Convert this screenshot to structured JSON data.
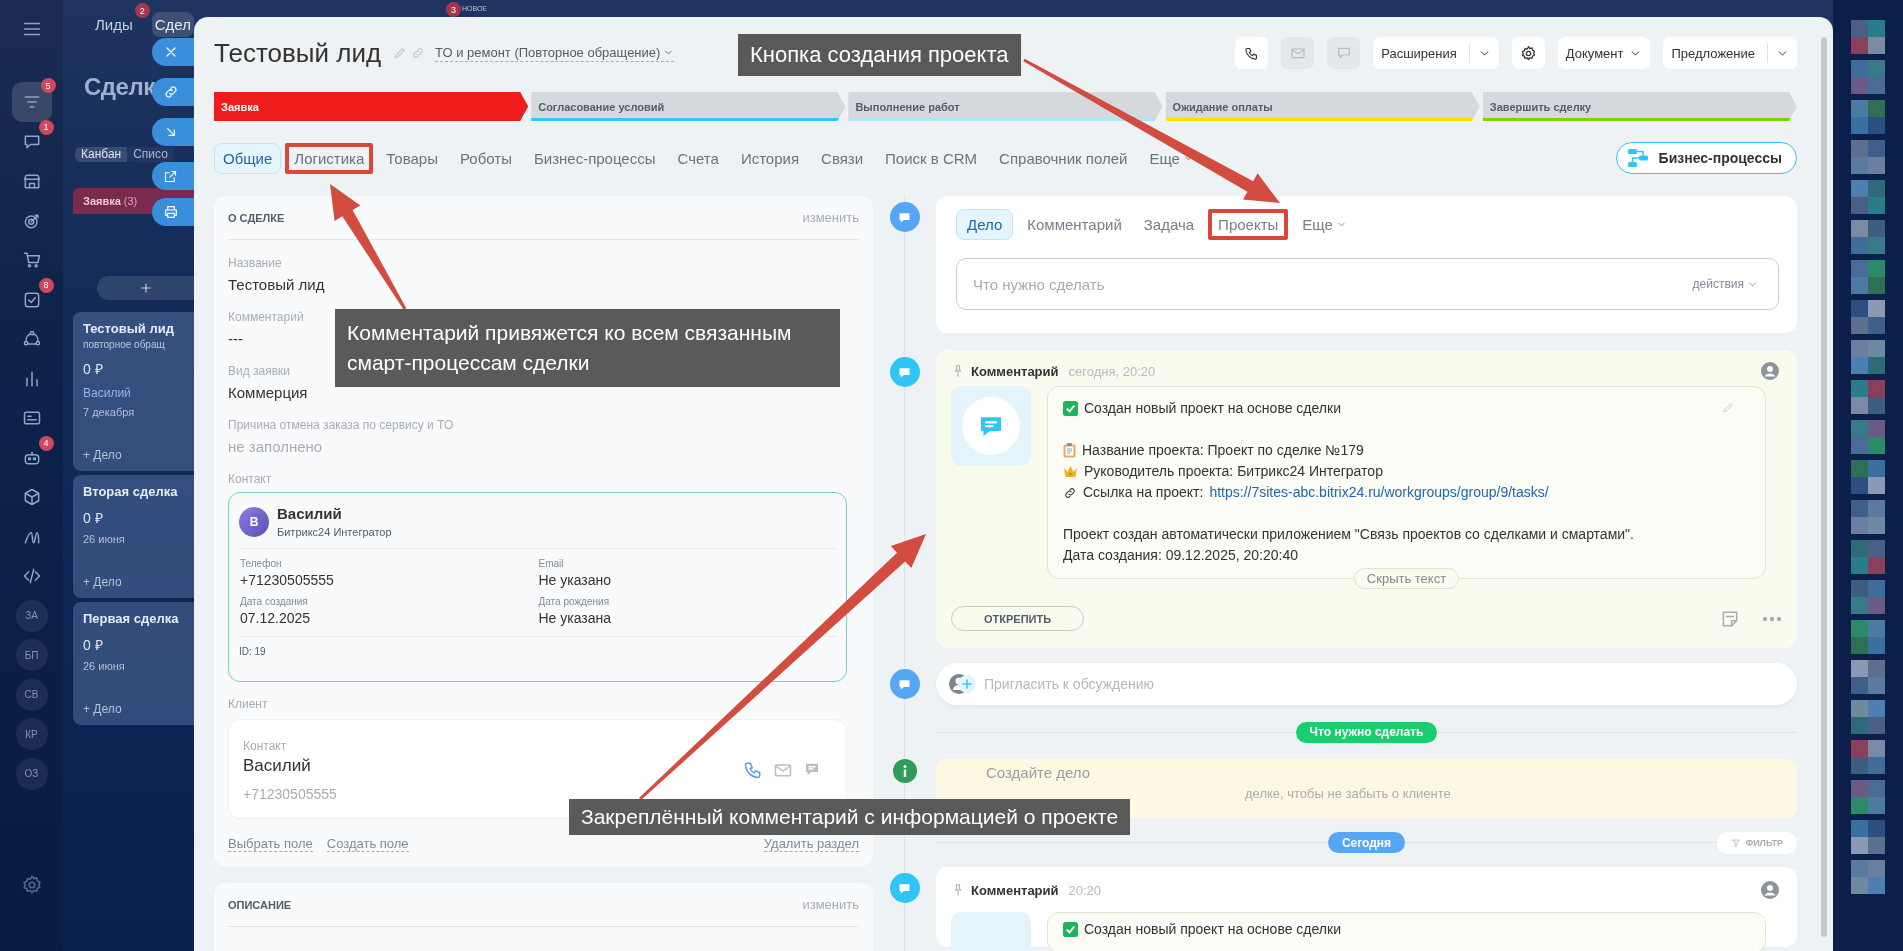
{
  "left_nav": {
    "items": [
      {
        "kind": "icon",
        "badge": "5",
        "selected": true
      },
      {
        "kind": "icon",
        "badge": "1",
        "selected": false
      },
      {
        "kind": "icon",
        "selected": false
      },
      {
        "kind": "icon",
        "selected": false
      },
      {
        "kind": "icon",
        "selected": false
      },
      {
        "kind": "icon",
        "badge": "8",
        "selected": false
      },
      {
        "kind": "icon",
        "selected": false
      },
      {
        "kind": "icon",
        "selected": false
      },
      {
        "kind": "icon",
        "selected": false
      },
      {
        "kind": "icon",
        "badge": "4",
        "selected": false
      },
      {
        "kind": "icon",
        "selected": false
      },
      {
        "kind": "icon",
        "selected": false
      },
      {
        "kind": "icon",
        "selected": false
      },
      {
        "kind": "text",
        "label": "ЗА",
        "selected": false
      },
      {
        "kind": "text",
        "label": "БП",
        "selected": false
      },
      {
        "kind": "text",
        "label": "СВ",
        "selected": false
      },
      {
        "kind": "text",
        "label": "КР",
        "selected": false
      },
      {
        "kind": "text",
        "label": "ОЗ",
        "selected": false
      }
    ]
  },
  "kanban": {
    "top_tabs": [
      {
        "label": "Лиды",
        "badge": "2",
        "selected": false
      },
      {
        "label": "Сдел",
        "selected": true
      }
    ],
    "news": {
      "label": "НОВОЕ",
      "badge": "3"
    },
    "title": "Сделк",
    "view_tabs": [
      {
        "label": "Канбан",
        "selected": true
      },
      {
        "label": "Списо",
        "selected": false
      }
    ],
    "column": {
      "title": "Заявка",
      "count": "(3)",
      "color": "#7a2a4c"
    },
    "cards": [
      {
        "title": "Тестовый лид",
        "subtitle": "повторное обращ",
        "amount": "0 ₽",
        "contact": "Василий",
        "date": "7 декабря",
        "add": "+ Дело"
      },
      {
        "title": "Вторая сделка",
        "amount": "0 ₽",
        "date": "26 июня",
        "add": "+ Дело"
      },
      {
        "title": "Первая сделка",
        "amount": "0 ₽",
        "date": "26 июня",
        "add": "+ Дело"
      }
    ]
  },
  "deal": {
    "title": "Тестовый лид",
    "category": "ТО и ремонт (Повторное обращение)",
    "actions": [
      {
        "kind": "phone",
        "disabled": false
      },
      {
        "kind": "mail",
        "disabled": true
      },
      {
        "kind": "chat",
        "disabled": true
      },
      {
        "kind": "split",
        "label": "Расширения",
        "disabled": false
      },
      {
        "kind": "gear",
        "disabled": false
      },
      {
        "kind": "dropdown",
        "label": "Документ",
        "disabled": false
      },
      {
        "kind": "split",
        "label": "Предложение",
        "disabled": false
      }
    ]
  },
  "stages": [
    {
      "label": "Заявка",
      "color": "#ee1c1c",
      "selected": true
    },
    {
      "label": "Согласование условий",
      "color": "#2fc6f6",
      "selected": false
    },
    {
      "label": "Выполнение работ",
      "color": "#b3e3f7",
      "selected": false
    },
    {
      "label": "Ожидание оплаты",
      "color": "#ffe100",
      "selected": false
    },
    {
      "label": "Завершить сделку",
      "color": "#7bd500",
      "selected": false
    }
  ],
  "tabs": [
    {
      "label": "Общие",
      "kind": "tab",
      "selected": true,
      "highlighted": false
    },
    {
      "label": "Логистика",
      "kind": "tab",
      "selected": false,
      "highlighted": true
    },
    {
      "label": "Товары",
      "kind": "tab",
      "selected": false,
      "highlighted": false
    },
    {
      "label": "Роботы",
      "kind": "tab",
      "selected": false,
      "highlighted": false
    },
    {
      "label": "Бизнес-процессы",
      "kind": "tab",
      "selected": false,
      "highlighted": false
    },
    {
      "label": "Счета",
      "kind": "tab",
      "selected": false,
      "highlighted": false
    },
    {
      "label": "История",
      "kind": "tab",
      "selected": false,
      "highlighted": false
    },
    {
      "label": "Связи",
      "kind": "tab",
      "selected": false,
      "highlighted": false
    },
    {
      "label": "Поиск в CRM",
      "kind": "tab",
      "selected": false,
      "highlighted": false
    },
    {
      "label": "Справочник полей",
      "kind": "tab",
      "selected": false,
      "highlighted": false
    },
    {
      "label": "Еще",
      "kind": "more",
      "selected": false,
      "highlighted": false
    }
  ],
  "bp_button": "Бизнес-процессы",
  "about": {
    "title": "О СДЕЛКЕ",
    "edit": "изменить",
    "fields": [
      {
        "label": "Название",
        "value": "Тестовый лид",
        "empty": false
      },
      {
        "label": "Комментарий",
        "value": "---",
        "empty": false
      },
      {
        "label": "Вид заявки",
        "value": "Коммерция",
        "empty": false
      },
      {
        "label": "Причина отмена заказа по сервису и ТО",
        "value": "не заполнено",
        "empty": true
      }
    ],
    "contact_label": "Контакт",
    "contact": {
      "initial": "В",
      "name": "Василий",
      "company": "Битрикс24 Интегратор",
      "details": [
        {
          "label": "Телефон",
          "value": "+71230505555"
        },
        {
          "label": "Email",
          "value": "Не указано"
        },
        {
          "label": "Дата создания",
          "value": "07.12.2025"
        },
        {
          "label": "Дата рождения",
          "value": "Не указана"
        }
      ],
      "id": "ID: 19"
    },
    "client_label": "Клиент",
    "client": {
      "label": "Контакт",
      "name": "Василий",
      "phone": "+71230505555"
    },
    "links": [
      "Выбрать поле",
      "Создать поле"
    ],
    "delete": "Удалить раздел"
  },
  "description": {
    "title": "ОПИСАНИЕ",
    "edit": "изменить"
  },
  "composer": {
    "tabs": [
      {
        "label": "Дело",
        "kind": "tab",
        "selected": true,
        "highlighted": false
      },
      {
        "label": "Комментарий",
        "kind": "tab",
        "selected": false,
        "highlighted": false
      },
      {
        "label": "Задача",
        "kind": "tab",
        "selected": false,
        "highlighted": false
      },
      {
        "label": "Проекты",
        "kind": "tab",
        "selected": false,
        "highlighted": true
      },
      {
        "label": "Еще",
        "kind": "more",
        "selected": false,
        "highlighted": false
      }
    ],
    "placeholder": "Что нужно сделать",
    "actions": "действия"
  },
  "pinned_comment": {
    "pinned": true,
    "title": "Комментарий",
    "time": "сегодня, 20:20",
    "lines": [
      {
        "kind": "check",
        "text": "Создан новый проект на основе сделки"
      },
      {
        "kind": "blank"
      },
      {
        "kind": "clipboard",
        "text": "Название проекта: Проект по сделке №179"
      },
      {
        "kind": "crown",
        "text": "Руководитель проекта: Битрикс24 Интегратор"
      },
      {
        "kind": "link",
        "text": "Ссылка на проект:",
        "url": "https://7sites-abc.bitrix24.ru/workgroups/group/9/tasks/"
      },
      {
        "kind": "blank"
      },
      {
        "kind": "text",
        "text": "Проект создан автоматически приложением \"Связь проектов со сделками и смартами\"."
      },
      {
        "kind": "text",
        "text": "Дата создания: 09.12.2025, 20:20:40"
      }
    ],
    "toggle": "Скрыть текст",
    "unpin": "ОТКРЕПИТЬ"
  },
  "invite": {
    "placeholder": "Пригласить к обсуждению"
  },
  "todo_divider": "Что нужно сделать",
  "todo": {
    "title": "Создайте дело",
    "text": "делке, чтобы не забыть о клиенте"
  },
  "today_divider": "Сегодня",
  "filter": "ФИЛЬТР",
  "comment": {
    "pinned": true,
    "title": "Комментарий",
    "time": "20:20",
    "lines": [
      {
        "kind": "check",
        "text": "Создан новый проект на основе сделки"
      }
    ]
  },
  "annotations": [
    {
      "text": "Кнопка создания проекта"
    },
    {
      "text": "Комментарий привяжется ко всем связанным смарт-процессам сделки"
    },
    {
      "text": "Закреплённый комментарий с информацией о проекте"
    }
  ]
}
